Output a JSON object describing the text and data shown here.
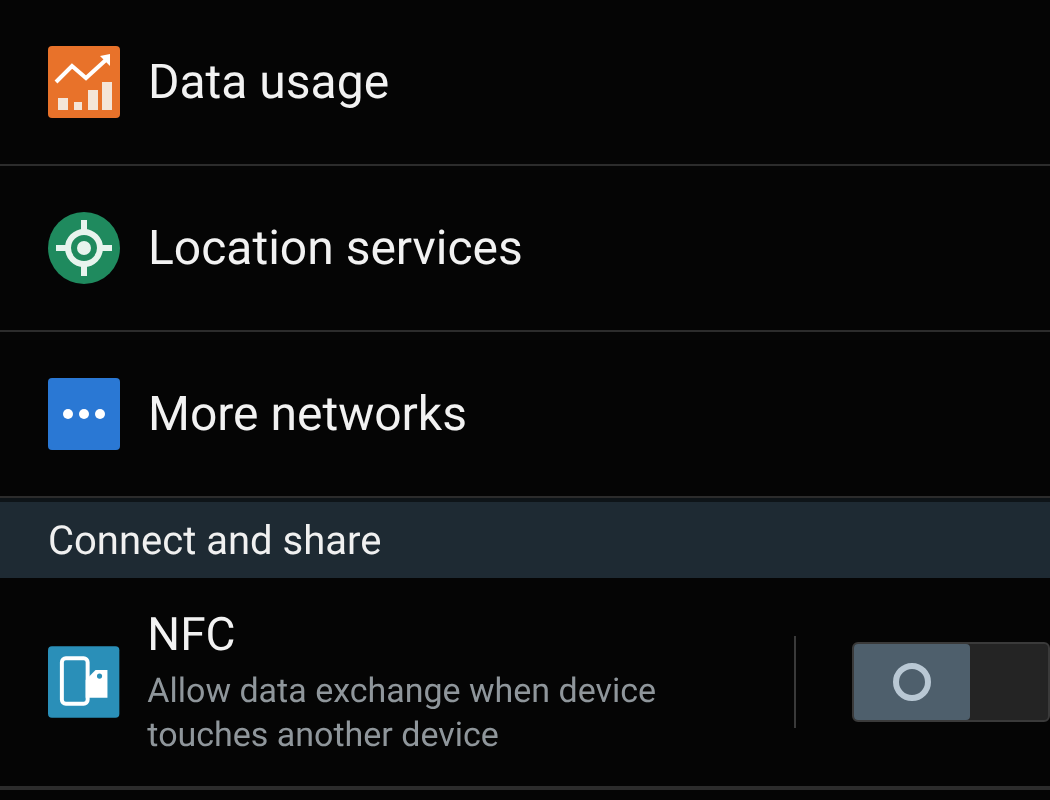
{
  "items": [
    {
      "kind": "data-usage",
      "label": "Data usage"
    },
    {
      "kind": "location",
      "label": "Location services"
    },
    {
      "kind": "more",
      "label": "More networks"
    }
  ],
  "section": {
    "title": "Connect and share"
  },
  "nfc": {
    "title": "NFC",
    "summary": "Allow data exchange when device touches another device",
    "on": false
  }
}
